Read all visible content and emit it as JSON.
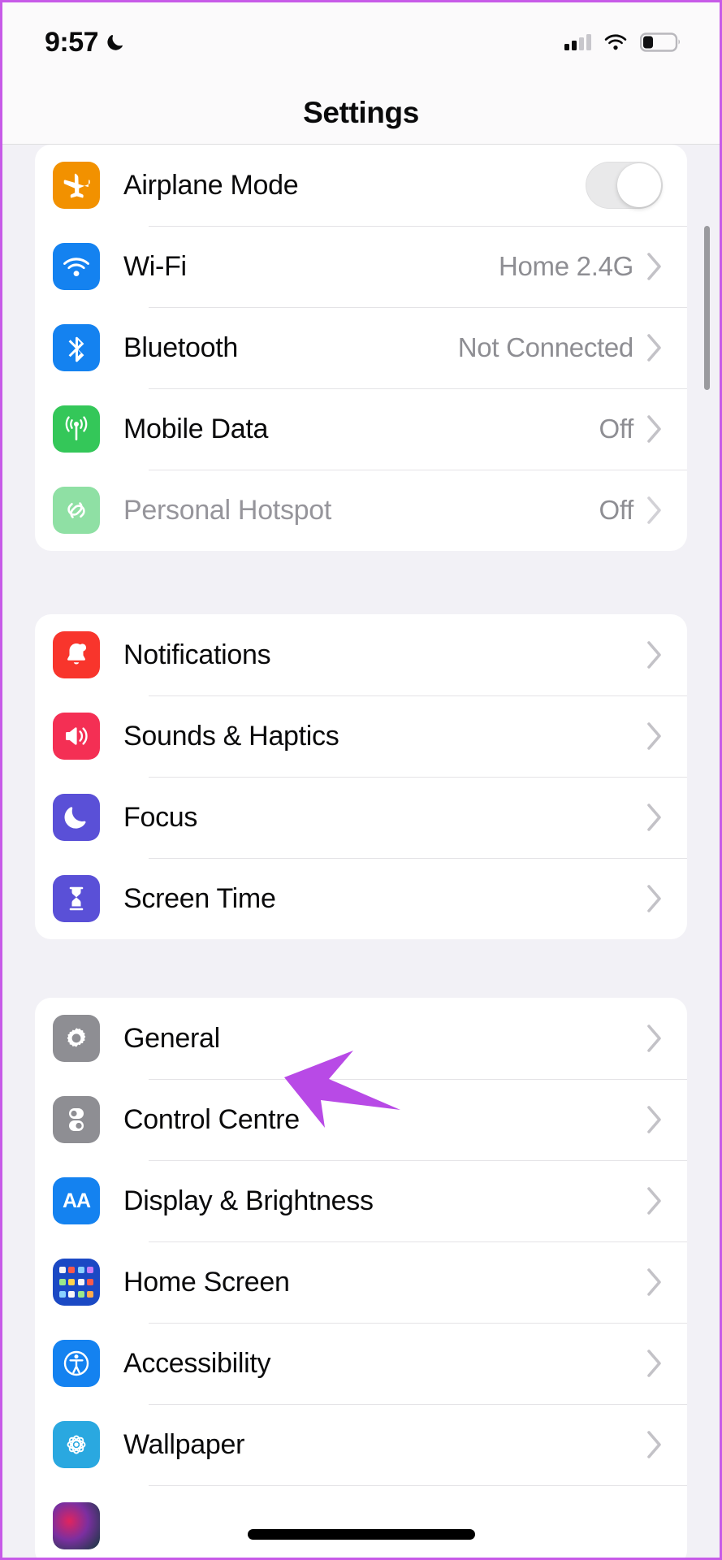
{
  "status_bar": {
    "time": "9:57",
    "dnd_icon": "crescent-moon-icon",
    "cellular_icon": "cellular-signal-icon",
    "cellular_bars_filled": 2,
    "cellular_bars_total": 4,
    "wifi_icon": "wifi-icon",
    "battery_icon": "battery-low-icon",
    "battery_level_percent": 28
  },
  "navbar": {
    "title": "Settings"
  },
  "annotation": {
    "type": "arrow",
    "color": "#b84ae6",
    "points_at": "General"
  },
  "groups": [
    {
      "id": "connectivity",
      "rows": [
        {
          "label": "Airplane Mode",
          "icon": "airplane-icon",
          "icon_color": "#f29100",
          "accessory": "toggle",
          "toggle_on": false,
          "disabled": false
        },
        {
          "label": "Wi-Fi",
          "icon": "wifi-icon",
          "icon_color": "#1482f0",
          "accessory": "value",
          "value": "Home 2.4G",
          "disabled": false
        },
        {
          "label": "Bluetooth",
          "icon": "bluetooth-icon",
          "icon_color": "#1482f0",
          "accessory": "value",
          "value": "Not Connected",
          "disabled": false
        },
        {
          "label": "Mobile Data",
          "icon": "mobile-data-icon",
          "icon_color": "#34c759",
          "accessory": "value",
          "value": "Off",
          "disabled": false
        },
        {
          "label": "Personal Hotspot",
          "icon": "personal-hotspot-icon",
          "icon_color": "#8fe0a4",
          "accessory": "value",
          "value": "Off",
          "disabled": true
        }
      ]
    },
    {
      "id": "alerts",
      "rows": [
        {
          "label": "Notifications",
          "icon": "bell-icon",
          "icon_color": "#f8352c",
          "accessory": "chevron",
          "disabled": false
        },
        {
          "label": "Sounds & Haptics",
          "icon": "speaker-icon",
          "icon_color": "#f42f54",
          "accessory": "chevron",
          "disabled": false
        },
        {
          "label": "Focus",
          "icon": "moon-icon",
          "icon_color": "#5a50d7",
          "accessory": "chevron",
          "disabled": false
        },
        {
          "label": "Screen Time",
          "icon": "hourglass-icon",
          "icon_color": "#5a50d7",
          "accessory": "chevron",
          "disabled": false
        }
      ]
    },
    {
      "id": "system",
      "rows": [
        {
          "label": "General",
          "icon": "gear-icon",
          "icon_color": "#8e8e93",
          "accessory": "chevron",
          "disabled": false
        },
        {
          "label": "Control Centre",
          "icon": "control-centre-icon",
          "icon_color": "#8e8e93",
          "accessory": "chevron",
          "disabled": false
        },
        {
          "label": "Display & Brightness",
          "icon": "display-brightness-icon",
          "icon_color": "#1482f0",
          "icon_text": "AA",
          "accessory": "chevron",
          "disabled": false
        },
        {
          "label": "Home Screen",
          "icon": "home-screen-grid-icon",
          "icon_color": "#1b49c4",
          "accessory": "chevron",
          "disabled": false
        },
        {
          "label": "Accessibility",
          "icon": "accessibility-icon",
          "icon_color": "#1482f0",
          "accessory": "chevron",
          "disabled": false
        },
        {
          "label": "Wallpaper",
          "icon": "wallpaper-flower-icon",
          "icon_color": "#2aa8e0",
          "accessory": "chevron",
          "disabled": false
        }
      ]
    }
  ]
}
